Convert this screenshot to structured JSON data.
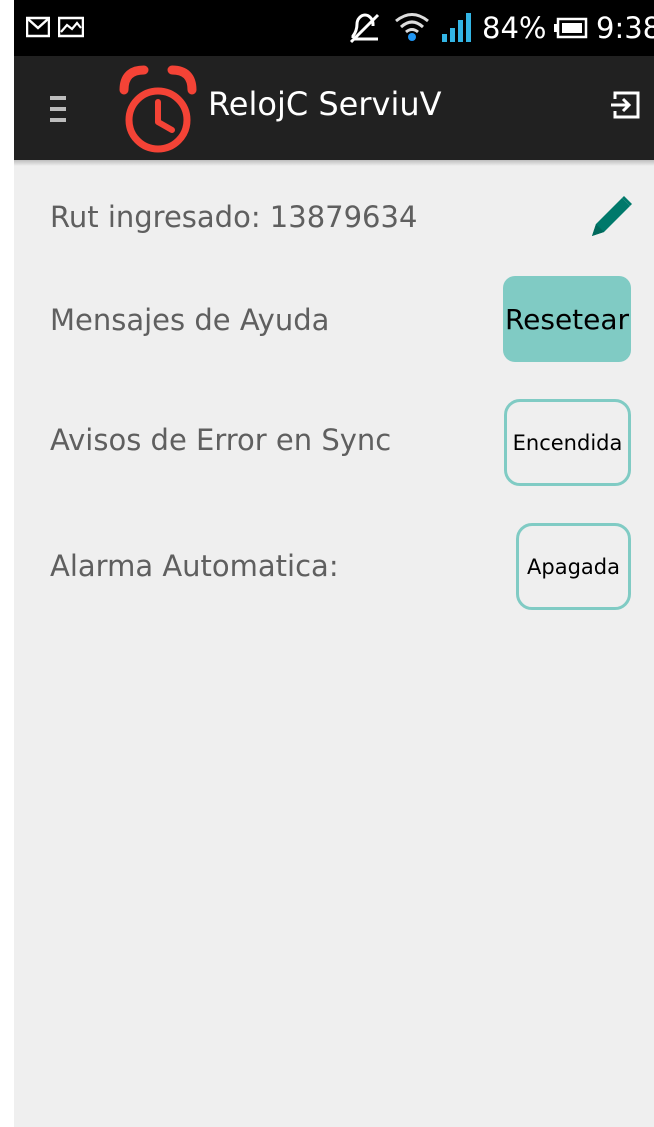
{
  "status_bar": {
    "battery_percent": "84%",
    "time": "9:38",
    "icons": [
      "gmail-icon",
      "gallery-icon",
      "mute-icon",
      "wifi-icon",
      "signal-icon",
      "battery-icon"
    ]
  },
  "app_bar": {
    "menu_icon": "menu-icon",
    "logo_icon": "alarm-clock-icon",
    "title": "RelojC ServiuV",
    "logout_icon": "logout-icon"
  },
  "settings": {
    "rut_label": "Rut ingresado: 13879634",
    "edit_icon": "pencil-icon",
    "help_label": "Mensajes de Ayuda",
    "reset_button": "Resetear",
    "sync_label": "Avisos de Error en Sync",
    "sync_toggle": "Encendida",
    "alarm_label": "Alarma Automatica:",
    "alarm_toggle": "Apagada"
  },
  "colors": {
    "status_bar_bg": "#000000",
    "app_bar_bg": "#212121",
    "background": "#efefef",
    "accent_teal": "#80cbc4",
    "pencil_green": "#00796b",
    "logo_red": "#f44336",
    "label_text": "#5f5f5f"
  }
}
